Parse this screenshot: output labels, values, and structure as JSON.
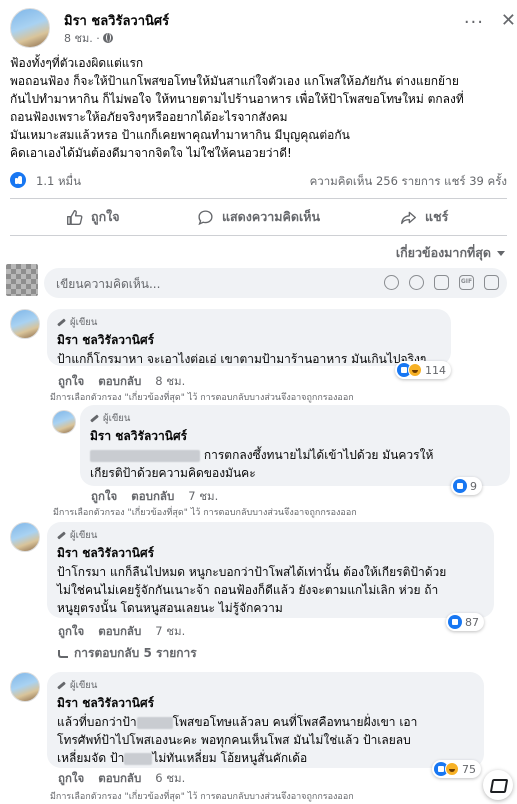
{
  "post": {
    "author": "มิรา ชลวิรัลวานิศร์",
    "time": "8 ชม. ·",
    "body": [
      "ฟ้องทั้งๆที่ตัวเองผิดแต่แรก",
      "พอถอนฟ้อง ก็จะให้ป้าแกโพสขอโทษให้มันสาแก่ใจตัวเอง แกโพสให้อภัยกัน ต่างแยกย้าย",
      "กันไปทำมาหากิน ก็ไม่พอใจ ให้ทนายตามไปร้านอาหาร เพื่อให้ป้าโพสขอโทษใหม่ ตกลงที่",
      "ถอนฟ้องเพราะให้อภัยจริงๆหรืออยากได้อะไรจากสังคม",
      "มันเหมาะสมแล้วหรอ ป้าแกก็เคยพาคุณทำมาหากิน มีบุญคุณต่อกัน",
      "คิดเอาเองได้มันต้องดีมาจากจิตใจ ไม่ใช่ให้คนอวยว่าดี!"
    ]
  },
  "stats": {
    "reactions": "1.1 หมื่น",
    "comments_shares": "ความคิดเห็น 256 รายการ  แชร์ 39 ครั้ง"
  },
  "actions": {
    "like": "ถูกใจ",
    "comment": "แสดงความคิดเห็น",
    "share": "แชร์"
  },
  "sort": {
    "label": "เกี่ยวข้องมากที่สุด"
  },
  "composer": {
    "placeholder": "เขียนความคิดเห็น..."
  },
  "labels": {
    "author_tag": "ผู้เขียน",
    "like": "ถูกใจ",
    "reply": "ตอบกลับ",
    "filter_note": "มีการเลือกตัวกรอง \"เกี่ยวข้องที่สุด\" ไว้ การตอบกลับบางส่วนจึงอาจถูกกรองออก"
  },
  "comments": [
    {
      "author": "มิรา ชลวิรัลวานิศร์",
      "lines": [
        "ป้าแกก็โกรมาหา จะเอาไงต่อเอ่ เขาตามป้ามาร้านอาหาร มันเกินไปจริงๆ"
      ],
      "time": "8 ชม.",
      "reactions": "114"
    },
    {
      "author": "มิรา ชลวิรัลวานิศร์",
      "line1_suffix": "การตกลงซึ้งทนายไม่ได้เข้าไปด้วย มันควรให้",
      "line2": "เกียรติป้าด้วยความคิดของมันคะ",
      "time": "7 ชม.",
      "reactions": "9"
    },
    {
      "author": "มิรา ชลวิรัลวานิศร์",
      "lines": [
        "ป้าโกรมา แกก็ลืนไปหมด หนูกะบอกว่าป้าโพสได้เท่านั้น ต้องให้เกียรติป้าด้วย",
        "ไม่ใช่คนไม่เคยรู้จักกันเนาะจ้า ถอนฟ้องก็ดีแล้ว ยังจะตามแกไม่เลิก ห่วย ถ้า",
        "หนูยุตรงนั้น โดนหนูสอนเลยนะ ไม่รู้จักความ"
      ],
      "time": "7 ชม.",
      "reactions": "87",
      "replies_link": "การตอบกลับ 5 รายการ"
    },
    {
      "author": "มิรา ชลวิรัลวานิศร์",
      "line1_prefix": "แล้วที่บอกว่าป้า",
      "line1_suffix": "โพสขอโทษแล้วลบ คนที่โพสคือทนายฝั่งเขา เอา",
      "line2": "โทรศัพท์ป้าไปโพสเองนะคะ พอทุกคนเห็นโพส มันไม่ใช่แล้ว ป้าเลยลบ",
      "line3_prefix": "เหลี่ยมจัด ป้า",
      "line3_suffix": "ไม่ทันเหลี่ยม โอ้ยหนูสั่นคักเด้อ",
      "time": "6 ชม.",
      "reactions": "75"
    }
  ]
}
